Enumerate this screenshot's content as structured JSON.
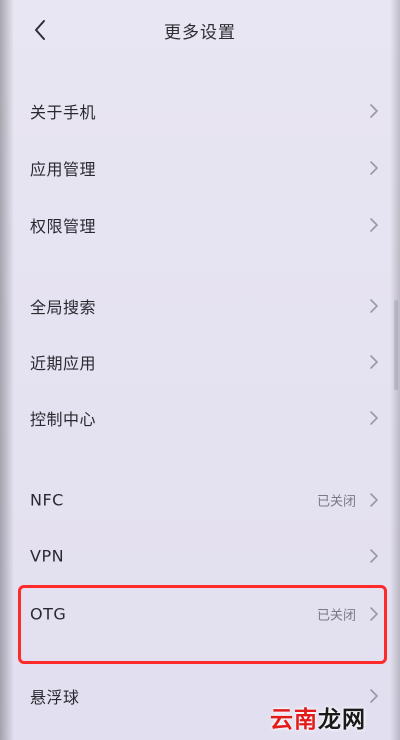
{
  "header": {
    "title": "更多设置",
    "back_icon": "chevron-left-icon"
  },
  "items": [
    {
      "label": "关于手机",
      "status": ""
    },
    {
      "label": "应用管理",
      "status": ""
    },
    {
      "label": "权限管理",
      "status": ""
    },
    {
      "label": "全局搜索",
      "status": ""
    },
    {
      "label": "近期应用",
      "status": ""
    },
    {
      "label": "控制中心",
      "status": ""
    },
    {
      "label": "NFC",
      "status": "已关闭"
    },
    {
      "label": "VPN",
      "status": ""
    },
    {
      "label": "OTG",
      "status": "已关闭"
    },
    {
      "label": "悬浮球",
      "status": ""
    }
  ],
  "highlight": {
    "target": "OTG",
    "color": "#ff2b2b"
  },
  "watermark": {
    "part_a": "云南",
    "part_b": "龙网"
  },
  "colors": {
    "background": "#e7e4f2",
    "text": "#2a2930",
    "status_text": "#7a7886",
    "chevron": "#9b98a6"
  }
}
